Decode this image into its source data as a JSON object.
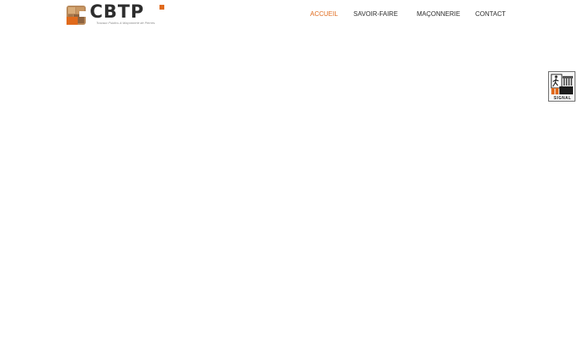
{
  "logo": {
    "brand": "CBTP",
    "tagline": "Travaux Publics & Maçonnerie de Pierres"
  },
  "nav": {
    "items": [
      {
        "label": "ACCUEIL",
        "active": true
      },
      {
        "label": "SAVOIR-FAIRE",
        "active": false
      },
      {
        "label": "MAÇONNERIE",
        "active": false
      },
      {
        "label": "CONTACT",
        "active": false
      }
    ]
  },
  "signal": {
    "label": "SIGNAL"
  },
  "colors": {
    "accent": "#e06a1c",
    "text": "#2b2b2b",
    "background": "#ffffff"
  }
}
